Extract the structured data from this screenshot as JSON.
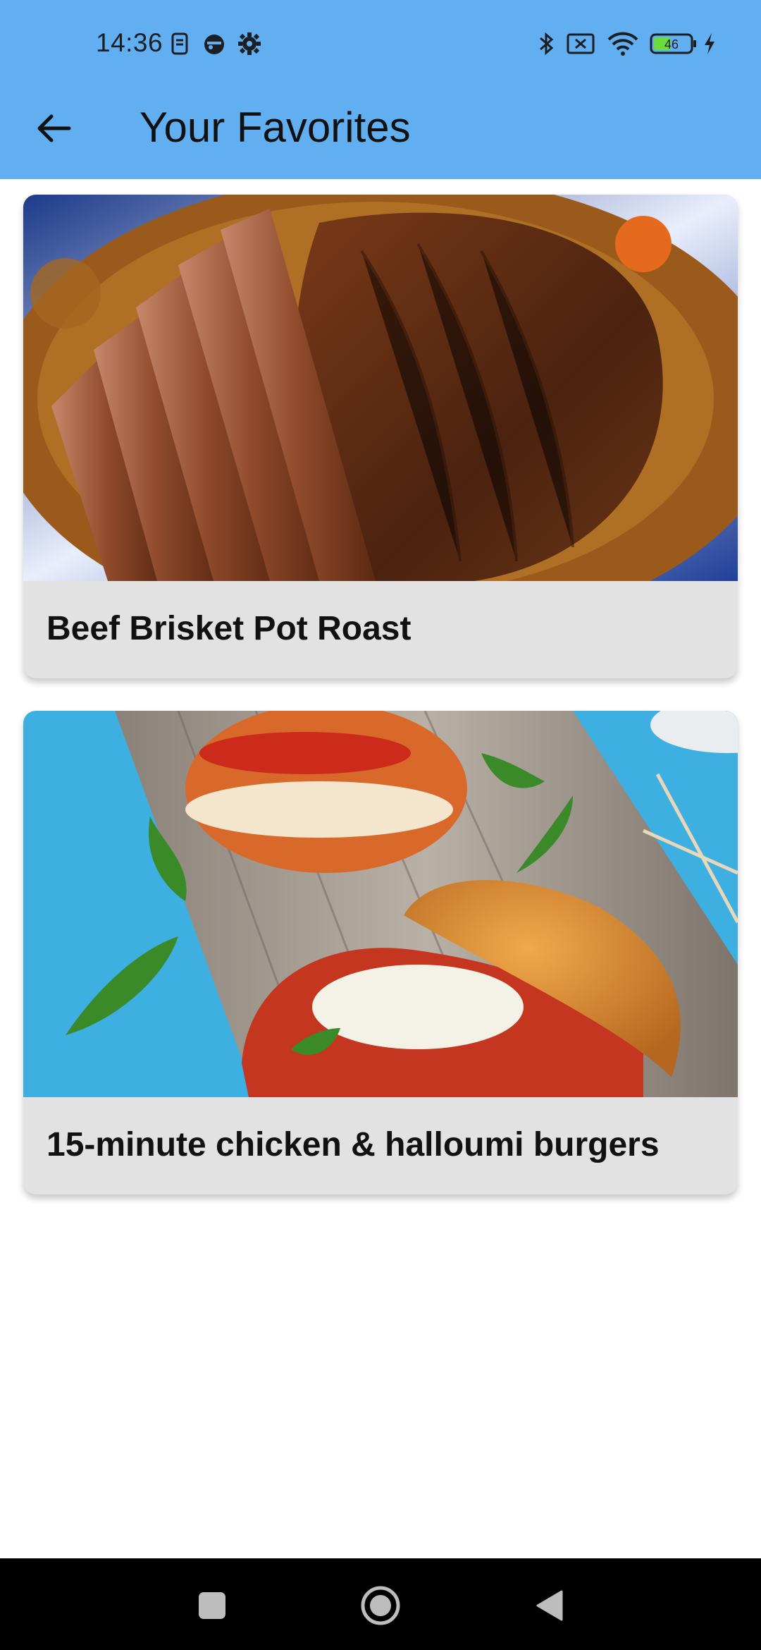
{
  "status_bar": {
    "time": "14:36",
    "battery_level": "46",
    "left_icons": [
      "sim-icon",
      "pirate-icon",
      "gear-icon"
    ],
    "right_icons": [
      "bluetooth-icon",
      "no-sim-icon",
      "wifi-icon",
      "battery-icon",
      "charging-icon"
    ]
  },
  "header": {
    "title": "Your Favorites",
    "back_icon": "arrow-left-icon",
    "background_color": "#61AEF0"
  },
  "favorites": [
    {
      "title": "Beef Brisket Pot Roast",
      "image": "beef-brisket-photo"
    },
    {
      "title": "15-minute chicken & halloumi burgers",
      "image": "halloumi-burger-photo"
    }
  ],
  "nav_bar": {
    "buttons": [
      "recents-icon",
      "home-icon",
      "back-triangle-icon"
    ]
  }
}
